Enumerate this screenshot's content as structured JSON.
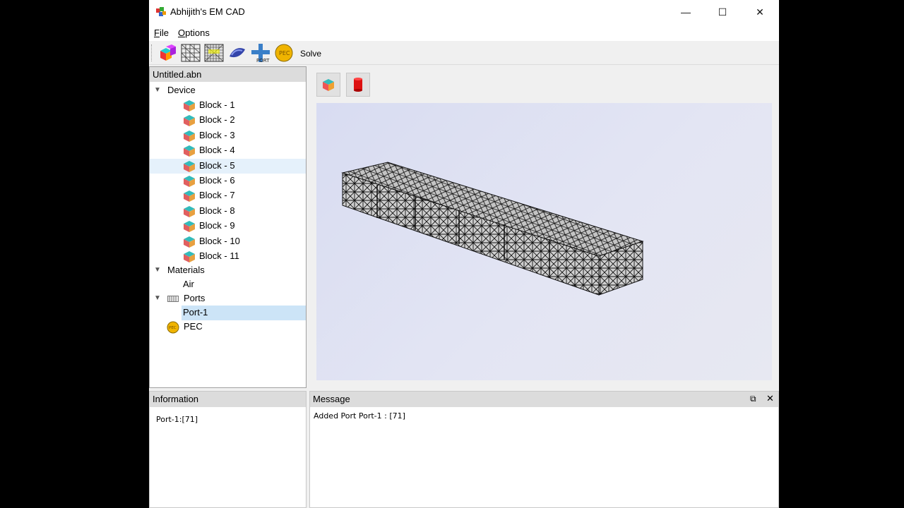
{
  "window": {
    "title": "Abhijith's EM CAD",
    "minimize": "—",
    "maximize": "☐",
    "close": "✕"
  },
  "menu": [
    {
      "letter": "F",
      "rest": "ile"
    },
    {
      "letter": "O",
      "rest": "ptions"
    }
  ],
  "toolbar": {
    "solve_label": "Solve"
  },
  "tree": {
    "header": "Untitled.abn",
    "device_label": "Device",
    "blocks": [
      "Block - 1",
      "Block - 2",
      "Block - 3",
      "Block - 4",
      "Block - 5",
      "Block - 6",
      "Block - 7",
      "Block - 8",
      "Block - 9",
      "Block - 10",
      "Block - 11"
    ],
    "materials_label": "Materials",
    "air_label": "Air",
    "ports_label": "Ports",
    "port1_label": "Port-1",
    "pec_label": "PEC",
    "pec_icon_text": "PEC"
  },
  "info": {
    "header": "Information",
    "content": "Port-1:[71]"
  },
  "message": {
    "header": "Message",
    "content": "Added Port Port-1 : [71]"
  },
  "colors": {
    "selection": "#cce4f7",
    "hover": "#e5f1fb",
    "header_bg": "#dcdcdc",
    "canvas_bg": "#dcdff3",
    "pec_gold": "#f0b400"
  },
  "icons": [
    "app-logo-icon",
    "block-icon",
    "mesh-icon",
    "refine-mesh-icon",
    "port-icon",
    "pec-icon",
    "cylinder-icon"
  ]
}
